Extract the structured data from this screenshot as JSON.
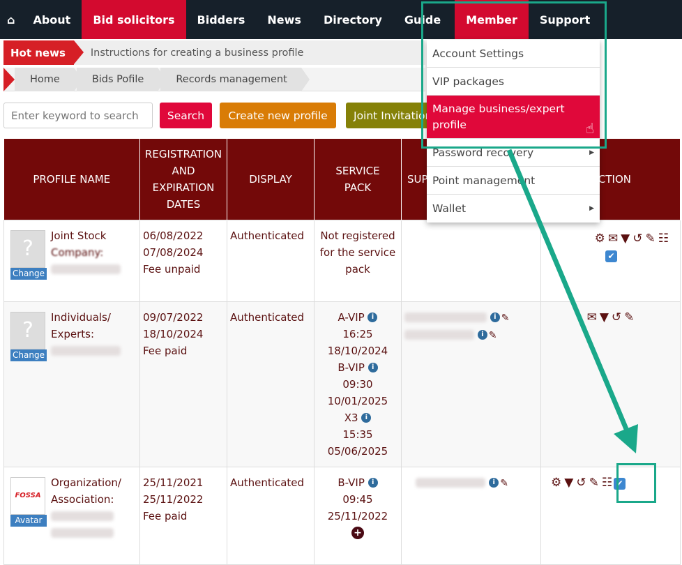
{
  "nav": {
    "home_icon": "home-icon",
    "items": [
      {
        "label": "About"
      },
      {
        "label": "Bid solicitors",
        "active": true
      },
      {
        "label": "Bidders"
      },
      {
        "label": "News"
      },
      {
        "label": "Directory"
      },
      {
        "label": "Guide"
      },
      {
        "label": "Member",
        "active": true
      },
      {
        "label": "Support"
      }
    ]
  },
  "hot_news": {
    "tag": "Hot news",
    "text": "Instructions for creating a business profile"
  },
  "breadcrumb": [
    "Home",
    "Bids Pofile",
    "Records management"
  ],
  "toolbar": {
    "search_placeholder": "Enter keyword to search",
    "search": "Search",
    "create": "Create new profile",
    "joint": "Joint Invitation"
  },
  "colors": {
    "nav_bg": "#16202a",
    "accent": "#d30a2f",
    "header_bg": "#730909",
    "create": "#d97c06",
    "joint": "#858108",
    "annotation": "#1aa88a"
  },
  "table": {
    "headers": [
      "PROFILE NAME",
      "REGISTRATION AND EXPIRATION DATES",
      "DISPLAY",
      "SERVICE PACK",
      "SUP",
      "CTION"
    ],
    "rows": [
      {
        "avatar_label": "Change",
        "name": [
          "Joint Stock",
          "Company: CÔNG TY CỔ"
        ],
        "dates": [
          "06/08/2022",
          "07/08/2024",
          "Fee unpaid"
        ],
        "display": "Authenticated",
        "pack": [
          "Not registered for the service pack"
        ]
      },
      {
        "avatar_label": "Change",
        "name": [
          "Individuals/",
          "Experts:"
        ],
        "dates": [
          "09/07/2022",
          "18/10/2024",
          "Fee paid"
        ],
        "display": "Authenticated",
        "pack": [
          "A-VIP",
          "16:25",
          "18/10/2024",
          "B-VIP",
          "09:30",
          "10/01/2025",
          "X3",
          "15:35",
          "05/06/2025"
        ]
      },
      {
        "avatar_label": "Avatar",
        "logo": "FOSSA",
        "name": [
          "Organization/",
          "Association:"
        ],
        "dates": [
          "25/11/2021",
          "25/11/2022",
          "Fee paid"
        ],
        "display": "Authenticated",
        "pack": [
          "B-VIP",
          "09:45",
          "25/11/2022"
        ]
      }
    ]
  },
  "menu": {
    "items": [
      {
        "label": "Account Settings"
      },
      {
        "label": "VIP packages"
      },
      {
        "label": "Manage business/expert profile",
        "selected": true
      },
      {
        "label": "Password recovery",
        "submenu": true
      },
      {
        "label": "Point management"
      },
      {
        "label": "Wallet",
        "submenu": true
      }
    ]
  }
}
